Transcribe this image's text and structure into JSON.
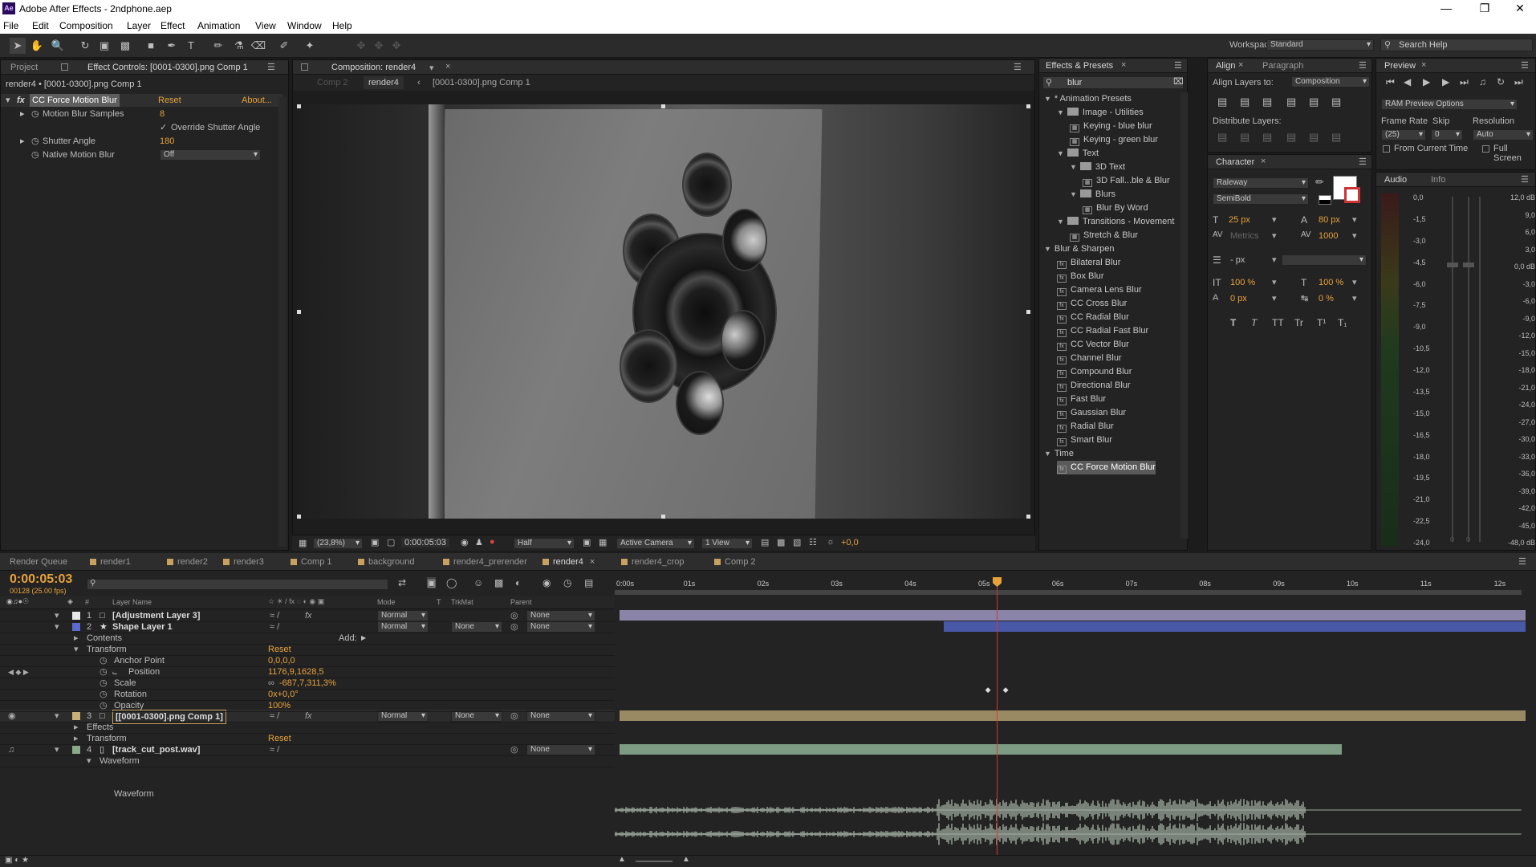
{
  "window": {
    "title": "Adobe After Effects - 2ndphone.aep",
    "app_icon": "Ae"
  },
  "menu": [
    "File",
    "Edit",
    "Composition",
    "Layer",
    "Effect",
    "Animation",
    "View",
    "Window",
    "Help"
  ],
  "toolbar": {
    "workspace_label": "Workspace:",
    "workspace_value": "Standard",
    "search_help": "Search Help"
  },
  "project_panel": {
    "tab_project": "Project",
    "tab_effect_controls": "Effect Controls: [0001-0300].png Comp 1",
    "subject": "render4 • [0001-0300].png Comp 1",
    "effect_name": "CC Force Motion Blur",
    "reset": "Reset",
    "about": "About...",
    "props": [
      {
        "label": "Motion Blur Samples",
        "value": "8"
      },
      {
        "label": "Override Shutter Angle",
        "value": ""
      },
      {
        "label": "Shutter Angle",
        "value": "180"
      },
      {
        "label": "Native Motion Blur",
        "value": "Off"
      }
    ]
  },
  "composition": {
    "tab": "Composition: render4",
    "crumbs": [
      "Comp 2",
      "render4",
      "[0001-0300].png Comp 1"
    ],
    "zoom": "(23,8%)",
    "timecode": "0:00:05:03",
    "resolution": "Half",
    "camera": "Active Camera",
    "views": "1 View",
    "exposure": "+0,0"
  },
  "effects_presets": {
    "title": "Effects & Presets",
    "search": "blur",
    "tree": [
      {
        "label": "* Animation Presets",
        "indent": 0,
        "kind": "open"
      },
      {
        "label": "Image - Utilities",
        "indent": 1,
        "kind": "folder"
      },
      {
        "label": "Keying - blue blur",
        "indent": 2,
        "kind": "preset"
      },
      {
        "label": "Keying - green blur",
        "indent": 2,
        "kind": "preset"
      },
      {
        "label": "Text",
        "indent": 1,
        "kind": "folder"
      },
      {
        "label": "3D Text",
        "indent": 2,
        "kind": "folder"
      },
      {
        "label": "3D Fall...ble & Blur",
        "indent": 3,
        "kind": "preset"
      },
      {
        "label": "Blurs",
        "indent": 2,
        "kind": "folder"
      },
      {
        "label": "Blur By Word",
        "indent": 3,
        "kind": "preset"
      },
      {
        "label": "Transitions - Movement",
        "indent": 1,
        "kind": "folder"
      },
      {
        "label": "Stretch & Blur",
        "indent": 2,
        "kind": "preset"
      },
      {
        "label": "Blur & Sharpen",
        "indent": 0,
        "kind": "open"
      },
      {
        "label": "Bilateral Blur",
        "indent": 1,
        "kind": "fx"
      },
      {
        "label": "Box Blur",
        "indent": 1,
        "kind": "fx"
      },
      {
        "label": "Camera Lens Blur",
        "indent": 1,
        "kind": "fx"
      },
      {
        "label": "CC Cross Blur",
        "indent": 1,
        "kind": "fx"
      },
      {
        "label": "CC Radial Blur",
        "indent": 1,
        "kind": "fx"
      },
      {
        "label": "CC Radial Fast Blur",
        "indent": 1,
        "kind": "fx"
      },
      {
        "label": "CC Vector Blur",
        "indent": 1,
        "kind": "fx"
      },
      {
        "label": "Channel Blur",
        "indent": 1,
        "kind": "fx"
      },
      {
        "label": "Compound Blur",
        "indent": 1,
        "kind": "fx"
      },
      {
        "label": "Directional Blur",
        "indent": 1,
        "kind": "fx"
      },
      {
        "label": "Fast Blur",
        "indent": 1,
        "kind": "fx"
      },
      {
        "label": "Gaussian Blur",
        "indent": 1,
        "kind": "fx"
      },
      {
        "label": "Radial Blur",
        "indent": 1,
        "kind": "fx"
      },
      {
        "label": "Smart Blur",
        "indent": 1,
        "kind": "fx"
      },
      {
        "label": "Time",
        "indent": 0,
        "kind": "open"
      },
      {
        "label": "CC Force Motion Blur",
        "indent": 1,
        "kind": "fx",
        "selected": true
      }
    ]
  },
  "align": {
    "tab_align": "Align",
    "tab_paragraph": "Paragraph",
    "align_to_label": "Align Layers to:",
    "align_to_value": "Composition",
    "distribute_label": "Distribute Layers:"
  },
  "character": {
    "tab": "Character",
    "font": "Raleway",
    "style": "SemiBold",
    "size": "25 px",
    "leading": "80 px",
    "kerning": "Metrics",
    "tracking": "1000",
    "stroke": "- px",
    "vscale": "100 %",
    "hscale": "100 %",
    "baseline": "0 px",
    "tsume": "0 %",
    "style_buttons": [
      "T",
      "T",
      "TT",
      "Tr",
      "T¹",
      "T₁"
    ]
  },
  "preview": {
    "tab": "Preview",
    "ram_options": "RAM Preview Options",
    "frame_rate_label": "Frame Rate",
    "skip_label": "Skip",
    "resolution_label": "Resolution",
    "frame_rate": "(25)",
    "skip": "0",
    "resolution": "Auto",
    "from_current": "From Current Time",
    "full_screen": "Full Screen"
  },
  "audio": {
    "tab_audio": "Audio",
    "tab_info": "Info",
    "left_scale": [
      "0,0",
      "-1,5",
      "-3,0",
      "-4,5",
      "-6,0",
      "-7,5",
      "-9,0",
      "-10,5",
      "-12,0",
      "-13,5",
      "-15,0",
      "-16,5",
      "-18,0",
      "-19,5",
      "-21,0",
      "-22,5",
      "-24,0"
    ],
    "right_scale": [
      "12,0 dB",
      "9,0",
      "6,0",
      "3,0",
      "0,0 dB",
      "-3,0",
      "-6,0",
      "-9,0",
      "-12,0",
      "-15,0",
      "-18,0",
      "-21,0",
      "-24,0",
      "-27,0",
      "-30,0",
      "-33,0",
      "-36,0",
      "-39,0",
      "-42,0",
      "-45,0",
      "-48,0 dB"
    ],
    "slider_zero_left": "0",
    "slider_zero_right": "0"
  },
  "timeline": {
    "tabs": [
      {
        "label": "Render Queue",
        "icon": false,
        "active": false
      },
      {
        "label": "render1",
        "icon": true,
        "active": false
      },
      {
        "label": "render2",
        "icon": true,
        "active": false
      },
      {
        "label": "render3",
        "icon": true,
        "active": false
      },
      {
        "label": "Comp 1",
        "icon": true,
        "active": false
      },
      {
        "label": "background",
        "icon": true,
        "active": false
      },
      {
        "label": "render4_prerender",
        "icon": true,
        "active": false
      },
      {
        "label": "render4",
        "icon": true,
        "active": true
      },
      {
        "label": "render4_crop",
        "icon": true,
        "active": false
      },
      {
        "label": "Comp 2",
        "icon": true,
        "active": false
      }
    ],
    "timecode": "0:00:05:03",
    "frame_info": "00128 (25.00 fps)",
    "columns": {
      "layer_name": "Layer Name",
      "mode": "Mode",
      "t": "T",
      "trkmat": "TrkMat",
      "parent": "Parent",
      "num": "#"
    },
    "ruler": [
      "0:00s",
      "01s",
      "02s",
      "03s",
      "04s",
      "05s",
      "06s",
      "07s",
      "08s",
      "09s",
      "10s",
      "11s",
      "12s"
    ],
    "current_time_s": 5.12,
    "layers": [
      {
        "num": "1",
        "name": "[Adjustment Layer 3]",
        "mode": "Normal",
        "trkmat": "",
        "parent": "None",
        "color": "#e8e8e8",
        "bar_start": 0,
        "bar_end": 12.3,
        "bar_color": "#8a84a8"
      },
      {
        "num": "2",
        "name": "Shape Layer 1",
        "mode": "Normal",
        "trkmat": "None",
        "parent": "None",
        "color": "#5a6ad0",
        "bar_start": 4.4,
        "bar_end": 12.3,
        "bar_color": "#4a58a8"
      },
      {
        "num": "3",
        "name": "[[0001-0300].png Comp 1]",
        "mode": "Normal",
        "trkmat": "None",
        "parent": "None",
        "color": "#c8b078",
        "bar_start": 0,
        "bar_end": 12.3,
        "bar_color": "#9a8a64"
      },
      {
        "num": "4",
        "name": "[track_cut_post.wav]",
        "mode": "",
        "trkmat": "",
        "parent": "None",
        "color": "#88aa88",
        "bar_start": 0,
        "bar_end": 9.8,
        "bar_color": "#7d9a82"
      }
    ],
    "shape_props": {
      "contents": "Contents",
      "add": "Add:",
      "transform": "Transform",
      "reset": "Reset",
      "anchor_label": "Anchor Point",
      "anchor_value": "0,0,0,0",
      "position_label": "Position",
      "position_value": "1176,9,1628,5",
      "scale_label": "Scale",
      "scale_value": "-687,7,311,3%",
      "rotation_label": "Rotation",
      "rotation_value": "0x+0,0°",
      "opacity_label": "Opacity",
      "opacity_value": "100%"
    },
    "comp_props": {
      "effects": "Effects",
      "transform": "Transform",
      "reset": "Reset"
    },
    "audio_props": {
      "waveform": "Waveform",
      "waveform2": "Waveform"
    }
  }
}
